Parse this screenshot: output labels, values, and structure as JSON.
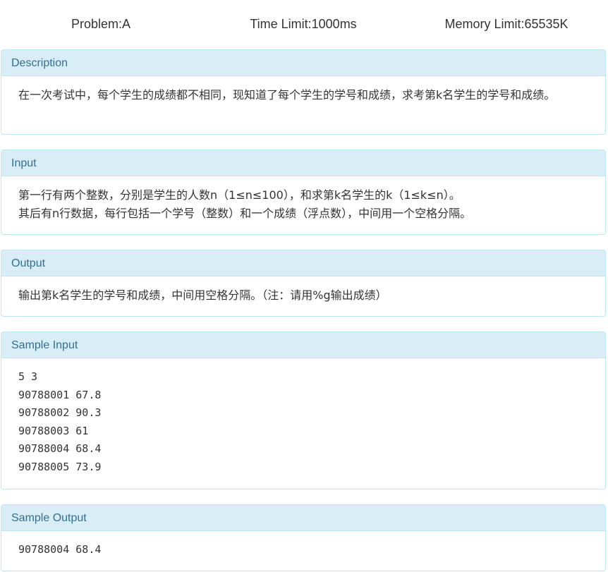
{
  "header": {
    "problem": "Problem:A",
    "time_limit": "Time Limit:1000ms",
    "memory_limit": "Memory Limit:65535K"
  },
  "sections": {
    "description": {
      "title": "Description",
      "lines": [
        "在一次考试中，每个学生的成绩都不相同，现知道了每个学生的学号和成绩，求考第k名学生的学号和成绩。"
      ]
    },
    "input": {
      "title": "Input",
      "lines": [
        "第一行有两个整数，分别是学生的人数n（1≤n≤100），和求第k名学生的k（1≤k≤n）。",
        "其后有n行数据，每行包括一个学号（整数）和一个成绩（浮点数），中间用一个空格分隔。"
      ]
    },
    "output": {
      "title": "Output",
      "lines": [
        "输出第k名学生的学号和成绩，中间用空格分隔。（注：请用%g输出成绩）"
      ]
    },
    "sample_input": {
      "title": "Sample Input",
      "lines": [
        "5 3",
        "90788001 67.8",
        "90788002 90.3",
        "90788003 61",
        "90788004 68.4",
        "90788005 73.9"
      ]
    },
    "sample_output": {
      "title": "Sample Output",
      "lines": [
        "90788004 68.4"
      ]
    }
  }
}
